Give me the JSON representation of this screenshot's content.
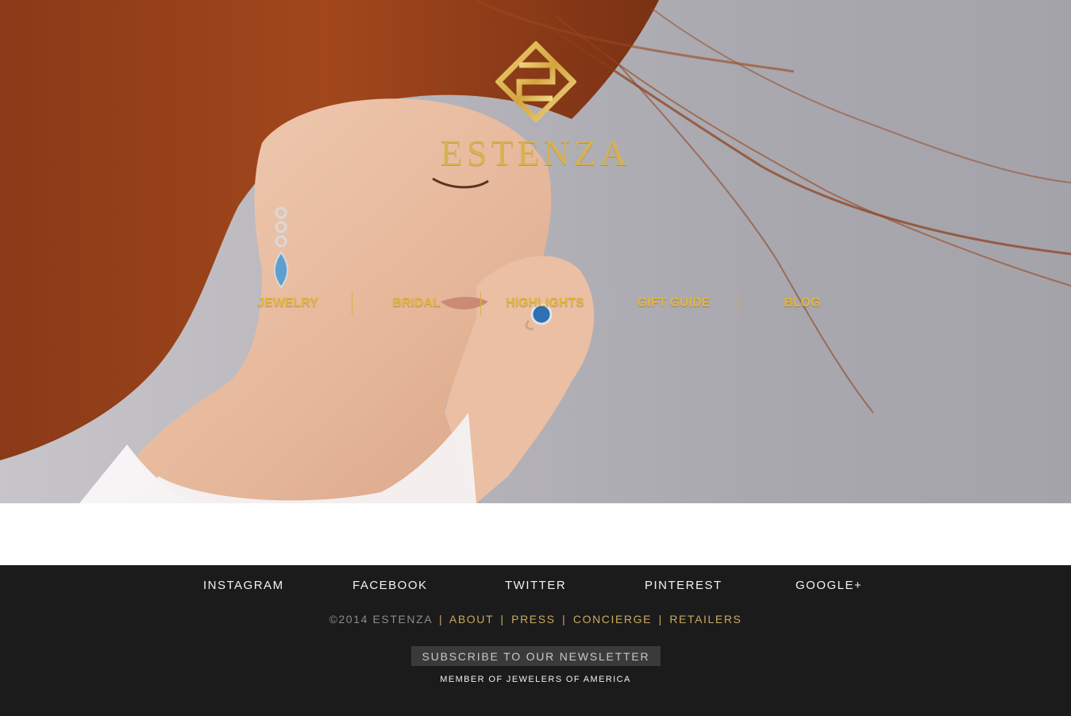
{
  "brand": {
    "name": "ESTENZA"
  },
  "nav": {
    "items": [
      {
        "label": "JEWELRY"
      },
      {
        "label": "BRIDAL"
      },
      {
        "label": "HIGHLIGHTS"
      },
      {
        "label": "GIFT GUIDE"
      },
      {
        "label": "BLOG"
      }
    ]
  },
  "footer": {
    "social": [
      {
        "label": "INSTAGRAM"
      },
      {
        "label": "FACEBOOK"
      },
      {
        "label": "TWITTER"
      },
      {
        "label": "PINTEREST"
      },
      {
        "label": "GOOGLE+"
      }
    ],
    "copyright": "©2014 ESTENZA",
    "links": [
      {
        "label": "ABOUT"
      },
      {
        "label": "PRESS"
      },
      {
        "label": "CONCIERGE"
      },
      {
        "label": "RETAILERS"
      }
    ],
    "subscribe_label": "SUBSCRIBE TO OUR NEWSLETTER",
    "member_text": "MEMBER OF JEWELERS OF AMERICA"
  },
  "colors": {
    "gold": "#e2b53f",
    "footer_bg": "#1b1b1c",
    "footer_link": "#c9a95b"
  },
  "icons": {
    "logo": "estenza-knot-logo",
    "earring": "drop-earring-gemstone",
    "ring": "sapphire-ring"
  }
}
